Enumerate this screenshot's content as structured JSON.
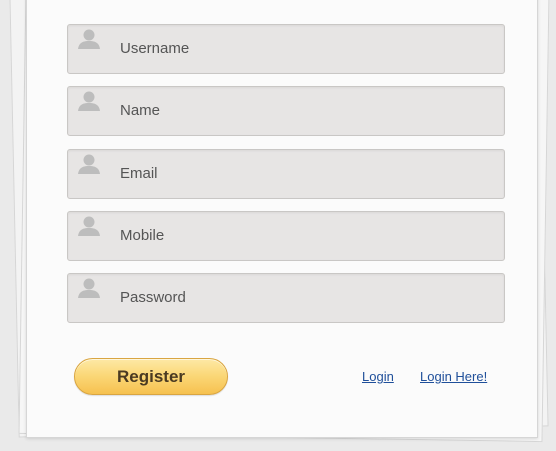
{
  "form": {
    "fields": [
      {
        "placeholder": "Username",
        "icon": "user-icon"
      },
      {
        "placeholder": "Name",
        "icon": "user-icon"
      },
      {
        "placeholder": "Email",
        "icon": "user-icon"
      },
      {
        "placeholder": "Mobile",
        "icon": "user-icon"
      },
      {
        "placeholder": "Password",
        "icon": "user-icon"
      }
    ],
    "register_label": "Register"
  },
  "links": {
    "login": "Login",
    "login_here": "Login Here!"
  },
  "colors": {
    "field_background": "#e7e5e4",
    "button_gradient_top": "#fde9a6",
    "button_gradient_bottom": "#f6c14f",
    "link": "#1f4f9a",
    "icon": "#bdbdbd"
  }
}
